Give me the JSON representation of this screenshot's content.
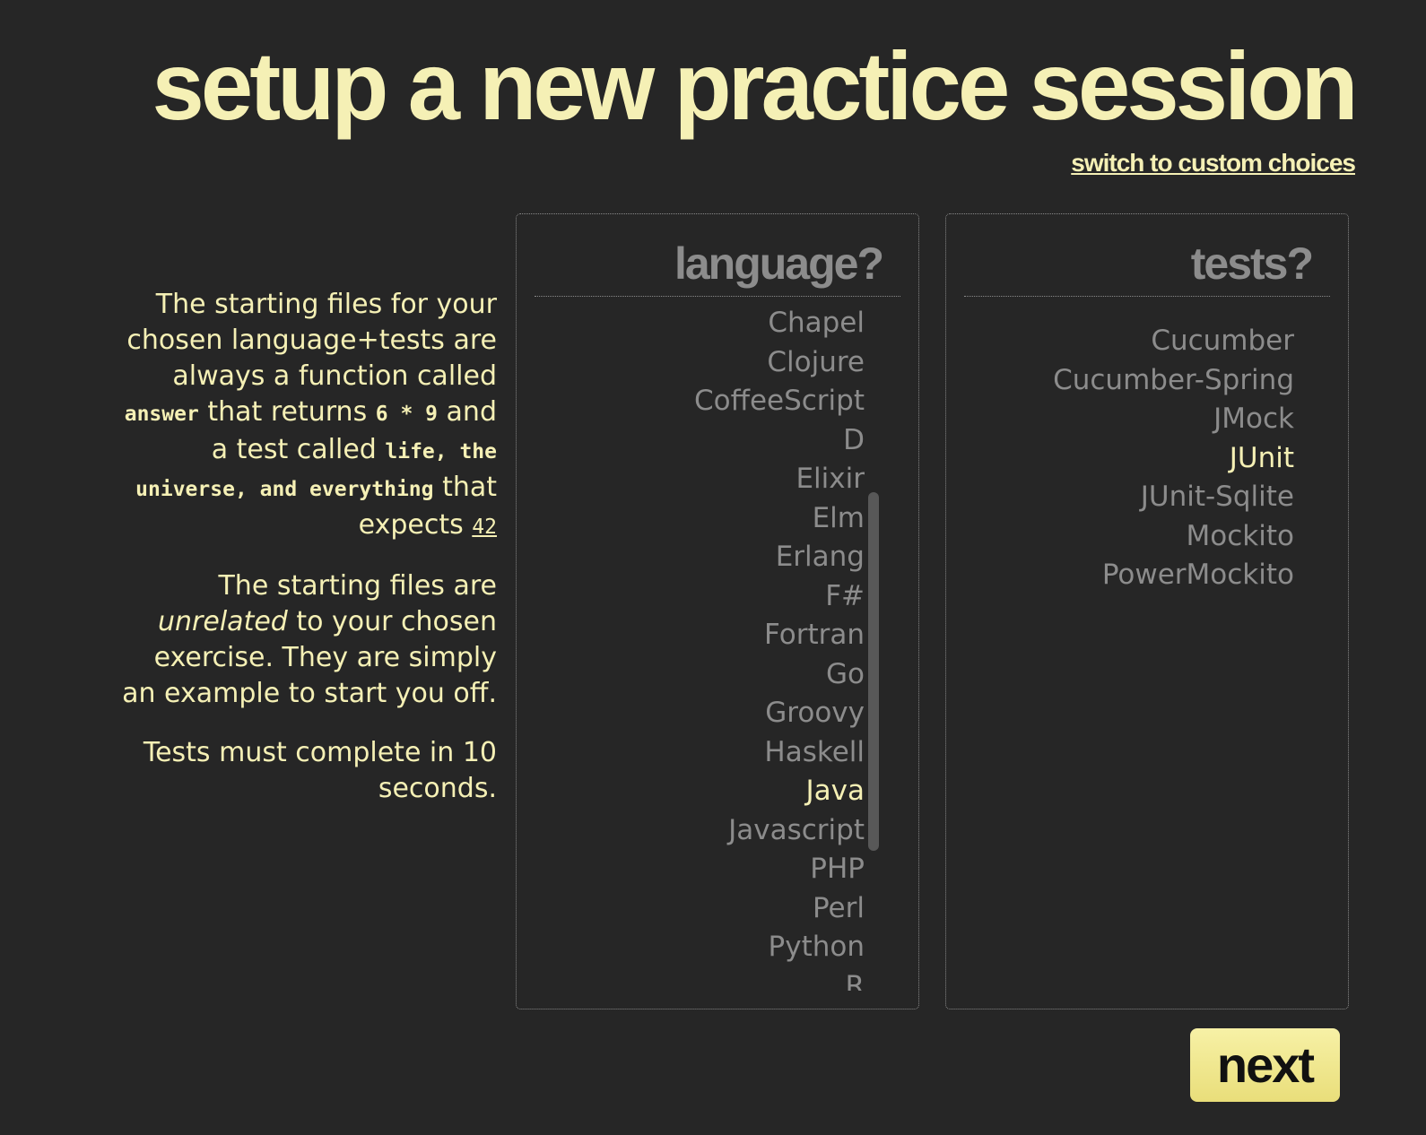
{
  "page": {
    "title": "setup a new practice session",
    "switch_link": "switch to custom choices"
  },
  "info": {
    "p1_a": "The starting files for your chosen language+tests are always a function called",
    "p1_code1": "answer",
    "p1_b": "that returns",
    "p1_code2": "6 * 9",
    "p1_c": "and a test called",
    "p1_code3": "life, the universe, and everything",
    "p1_d": "that expects",
    "p1_42": "42",
    "p2_a": "The starting files are",
    "p2_em": "unrelated",
    "p2_b": "to your chosen exercise. They are simply an example to start you off.",
    "p3": "Tests must complete in 10 seconds."
  },
  "language_panel": {
    "heading": "language?",
    "items": [
      "Chapel",
      "Clojure",
      "CoffeeScript",
      "D",
      "Elixir",
      "Elm",
      "Erlang",
      "F#",
      "Fortran",
      "Go",
      "Groovy",
      "Haskell",
      "Java",
      "Javascript",
      "PHP",
      "Perl",
      "Python",
      "R"
    ],
    "selected": "Java"
  },
  "tests_panel": {
    "heading": "tests?",
    "items": [
      "Cucumber",
      "Cucumber-Spring",
      "JMock",
      "JUnit",
      "JUnit-Sqlite",
      "Mockito",
      "PowerMockito"
    ],
    "selected": "JUnit"
  },
  "buttons": {
    "next": "next"
  },
  "colors": {
    "background": "#262626",
    "accent": "#f5f0b5",
    "muted": "#8c8c8c",
    "button": "#f1e98f"
  }
}
